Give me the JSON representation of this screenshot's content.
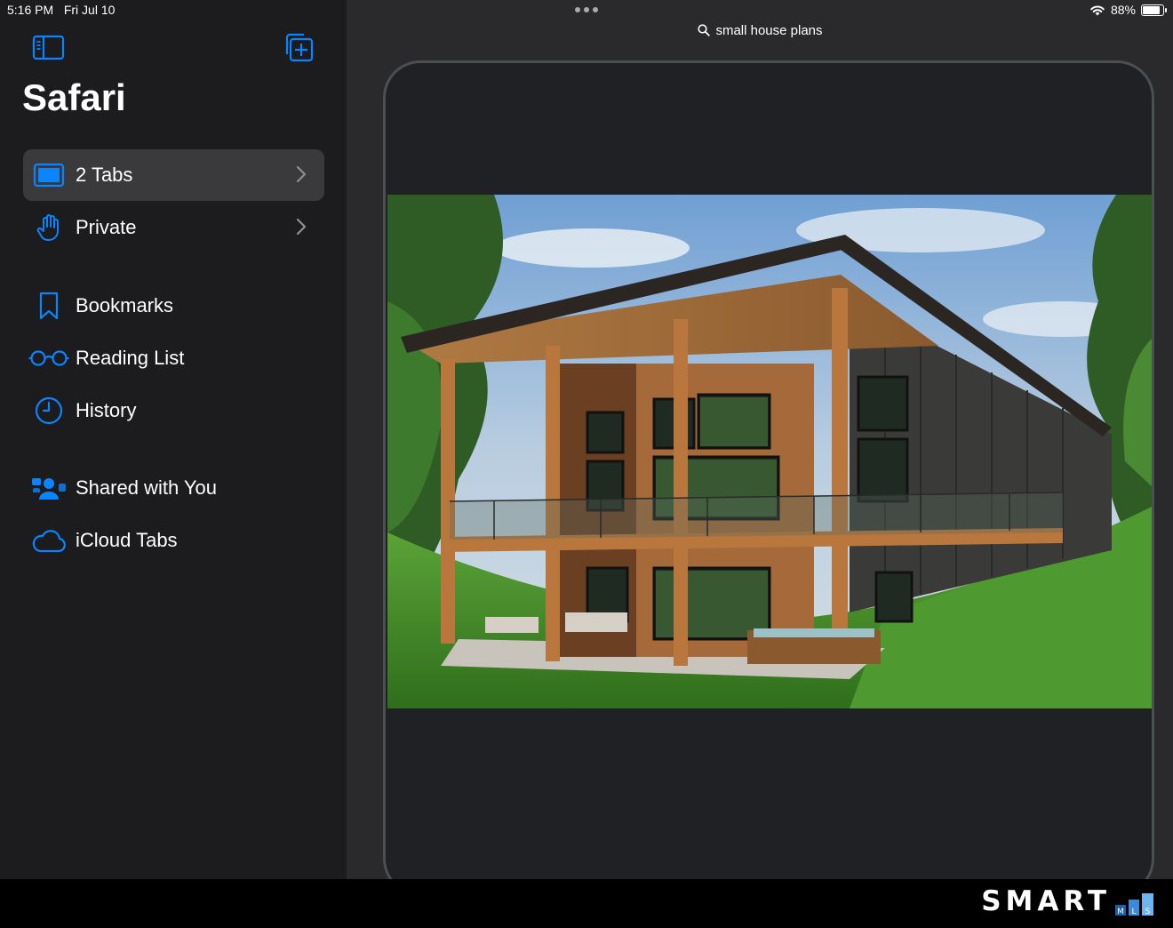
{
  "status_bar": {
    "time": "5:16 PM",
    "date": "Fri Jul 10",
    "battery_text": "88%",
    "battery_level": 0.88
  },
  "sidebar": {
    "title": "Safari",
    "groups": [
      {
        "label": "2 Tabs",
        "icon": "tablet-icon",
        "selected": true,
        "chevron": true
      },
      {
        "label": "Private",
        "icon": "hand-icon",
        "selected": false,
        "chevron": true
      }
    ],
    "collections": [
      {
        "label": "Bookmarks",
        "icon": "bookmark-icon"
      },
      {
        "label": "Reading List",
        "icon": "glasses-icon"
      },
      {
        "label": "History",
        "icon": "clock-icon"
      }
    ],
    "shared": [
      {
        "label": "Shared with You",
        "icon": "people-icon"
      },
      {
        "label": "iCloud Tabs",
        "icon": "cloud-icon"
      }
    ]
  },
  "main": {
    "search_text": "small house plans"
  },
  "footer": {
    "logo_text": "SMART",
    "logo_badge": [
      "M",
      "L",
      "S"
    ]
  },
  "colors": {
    "accent": "#0a84ff",
    "sidebar_bg": "#1c1c1e",
    "selected_bg": "#3a3a3c",
    "main_bg": "#2a2a2d"
  }
}
